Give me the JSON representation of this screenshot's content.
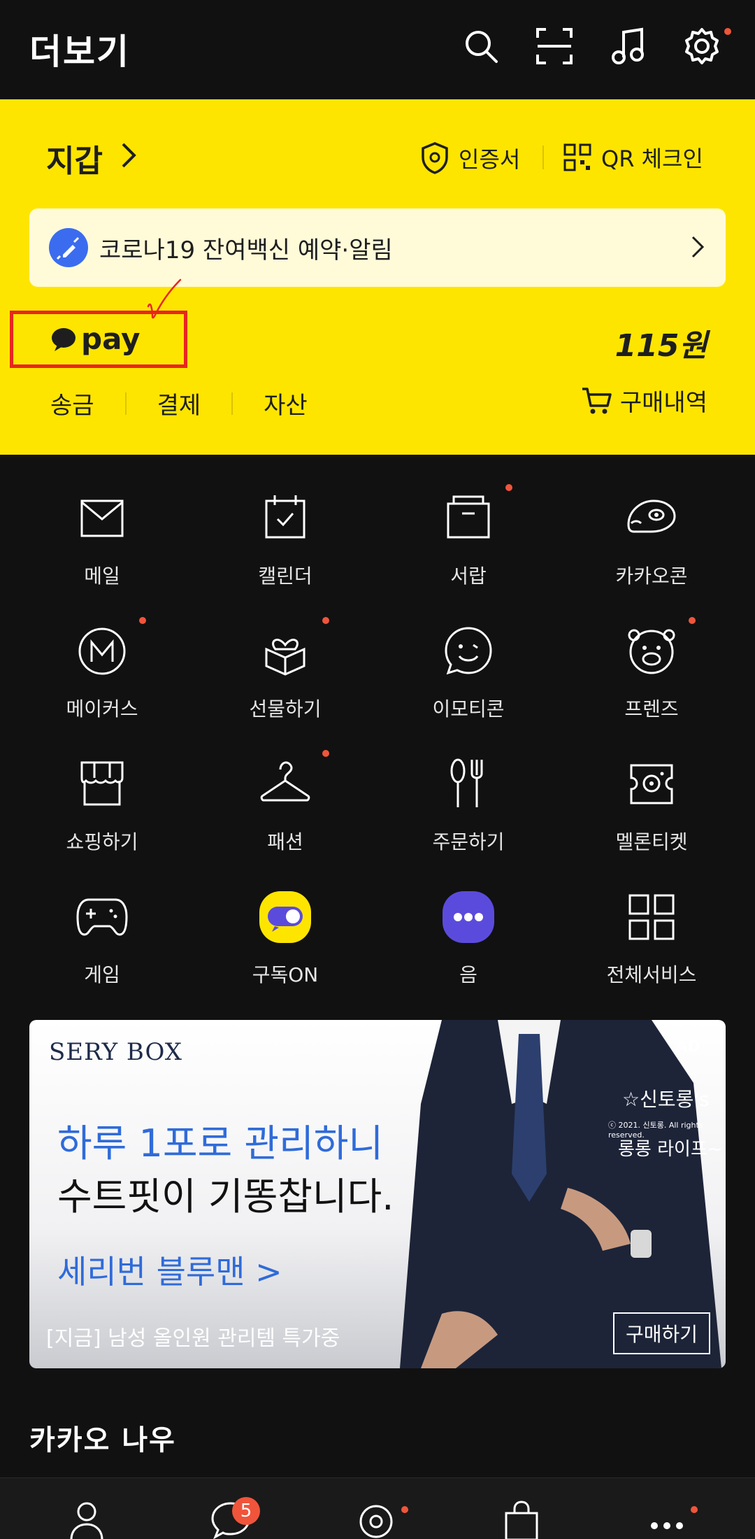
{
  "header": {
    "title": "더보기"
  },
  "wallet": {
    "title": "지갑",
    "certificate_label": "인증서",
    "qr_label": "QR 체크인",
    "banner_text": "코로나19 잔여백신 예약·알림",
    "pay_label": "pay",
    "balance": "115원",
    "links": [
      "송금",
      "결제",
      "자산"
    ],
    "purchase_label": "구매내역"
  },
  "services": [
    {
      "label": "메일",
      "icon": "mail-icon"
    },
    {
      "label": "캘린더",
      "icon": "calendar-icon"
    },
    {
      "label": "서랍",
      "icon": "drawer-icon"
    },
    {
      "label": "카카오콘",
      "icon": "kakaocon-icon"
    },
    {
      "label": "메이커스",
      "icon": "makers-icon"
    },
    {
      "label": "선물하기",
      "icon": "gift-icon"
    },
    {
      "label": "이모티콘",
      "icon": "emoticon-icon"
    },
    {
      "label": "프렌즈",
      "icon": "friends-icon"
    },
    {
      "label": "쇼핑하기",
      "icon": "shop-icon"
    },
    {
      "label": "패션",
      "icon": "hanger-icon"
    },
    {
      "label": "주문하기",
      "icon": "utensils-icon"
    },
    {
      "label": "멜론티켓",
      "icon": "ticket-icon"
    },
    {
      "label": "게임",
      "icon": "gamepad-icon"
    },
    {
      "label": "구독ON",
      "icon": "subscribe-icon"
    },
    {
      "label": "음",
      "icon": "eum-icon"
    },
    {
      "label": "전체서비스",
      "icon": "grid-icon"
    }
  ],
  "ad": {
    "brand": "SERY BOX",
    "tag": "AD",
    "line1": "하루 1포로 관리하니",
    "line2": "수트핏이 기똥찹니다.",
    "line3": "세리번 블루맨 >",
    "line4": "[지금] 남성 올인원 관리템 특가중",
    "button": "구매하기",
    "sub1": "☆신토롱's",
    "sub2": "ⓒ 2021. 신토롱. All rights reserved.",
    "sub3": "롱롱 라이프~"
  },
  "section_title": "카카오 나우",
  "bottom_nav": {
    "chat_badge": "5"
  },
  "colors": {
    "yellow": "#fee500",
    "accent": "#f0553b",
    "background": "#111111"
  }
}
